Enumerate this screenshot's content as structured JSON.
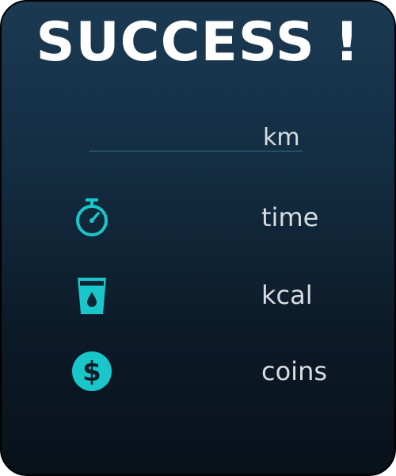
{
  "title": "SUCCESS !",
  "distance": {
    "unit": "km"
  },
  "stats": {
    "time": {
      "label": "time",
      "icon": "stopwatch-icon"
    },
    "kcal": {
      "label": "kcal",
      "icon": "water-cup-icon"
    },
    "coins": {
      "label": "coins",
      "icon": "dollar-coin-icon"
    }
  },
  "colors": {
    "accent": "#19c6c9",
    "background_top": "#1b3a52",
    "background_bottom": "#08111a",
    "text": "#d8dde2"
  }
}
